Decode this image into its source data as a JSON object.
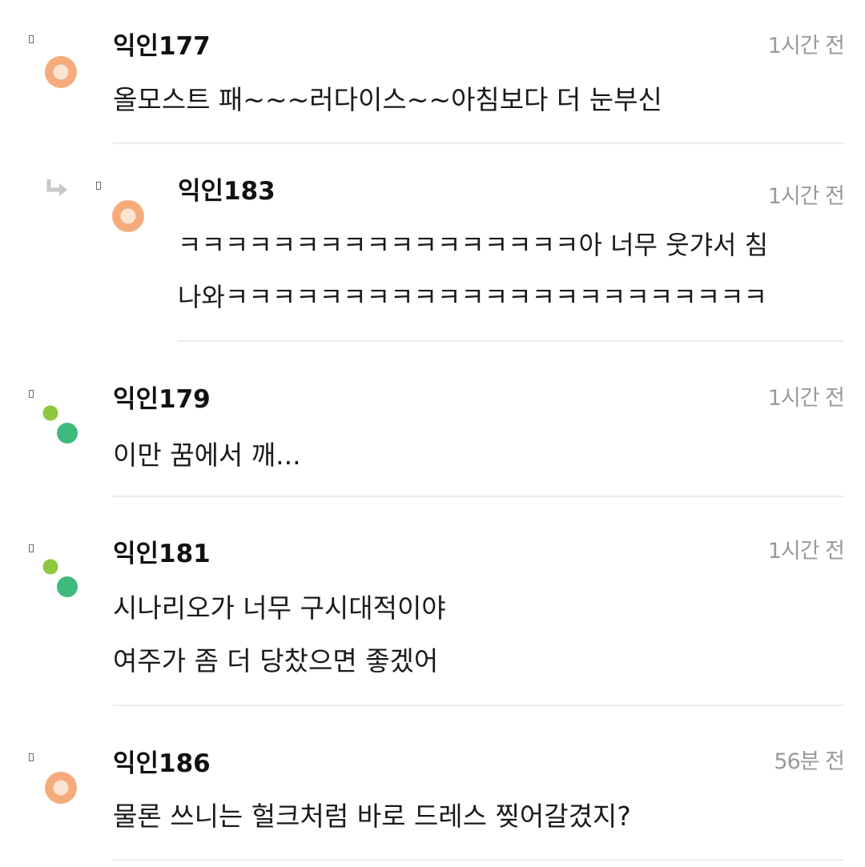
{
  "comments": [
    {
      "nickname": "익인177",
      "time": "1시간 전",
      "avatar": "orange-circle",
      "lines": [
        "올모스트 패~~~러다이스~~아침보다 더 눈부신"
      ]
    },
    {
      "nickname": "익인183",
      "time": "1시간 전",
      "avatar": "orange-circle",
      "is_reply": true,
      "lines": [
        "ㅋㅋㅋㅋㅋㅋㅋㅋㅋㅋㅋㅋㅋㅋㅋㅋㅋ아 너무 웃갸서 침",
        "나와ㅋㅋㅋㅋㅋㅋㅋㅋㅋㅋㅋㅋㅋㅋㅋㅋㅋㅋㅋㅋㅋㅋㅋ"
      ]
    },
    {
      "nickname": "익인179",
      "time": "1시간 전",
      "avatar": "green-dots",
      "lines": [
        "이만 꿈에서 깨..."
      ]
    },
    {
      "nickname": "익인181",
      "time": "1시간 전",
      "avatar": "green-dots",
      "lines": [
        "시나리오가 너무 구시대적이야",
        "여주가 좀 더 당찼으면 좋겠어"
      ]
    },
    {
      "nickname": "익인186",
      "time": "56분 전",
      "avatar": "orange-circle",
      "lines": [
        "물론 쓰니는 헐크처럼 바로 드레스 찢어갈겼지?"
      ]
    }
  ],
  "colors": {
    "avatar_orange_outer": "#f6ab7d",
    "avatar_orange_inner": "#fde3d2",
    "avatar_green_small": "#8fc73e",
    "avatar_green_big": "#3dba7c",
    "divider": "#ececec",
    "time_text": "#9a9a9a"
  },
  "icons": {
    "menu": "comment-menu-icon",
    "reply": "reply-arrow-icon"
  }
}
